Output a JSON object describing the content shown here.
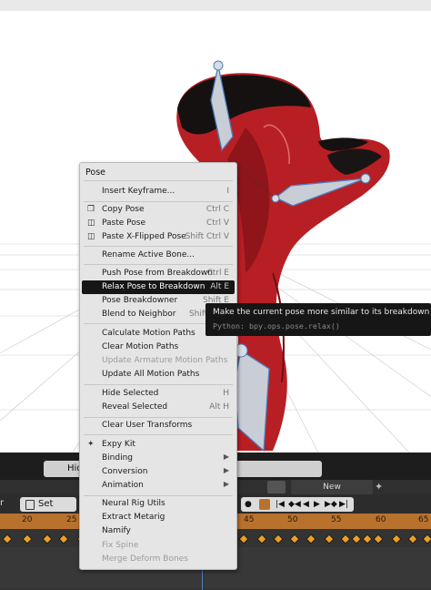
{
  "menu": {
    "title": "Pose",
    "items": [
      {
        "label": "Insert Keyframe...",
        "shortcut": "I",
        "icon": ""
      },
      {
        "label": "Copy Pose",
        "shortcut": "Ctrl C",
        "icon": "copy-icon"
      },
      {
        "label": "Paste Pose",
        "shortcut": "Ctrl V",
        "icon": "paste-icon"
      },
      {
        "label": "Paste X-Flipped Pose",
        "shortcut": "Shift Ctrl V",
        "icon": "paste-flipped-icon"
      },
      {
        "label": "Rename Active Bone...",
        "shortcut": ""
      },
      {
        "label": "Push Pose from Breakdown",
        "shortcut": "Ctrl E"
      },
      {
        "label": "Relax Pose to Breakdown",
        "shortcut": "Alt E"
      },
      {
        "label": "Pose Breakdowner",
        "shortcut": "Shift E"
      },
      {
        "label": "Blend to Neighbor",
        "shortcut": "Shift Alt E"
      },
      {
        "label": "Calculate Motion Paths",
        "shortcut": ""
      },
      {
        "label": "Clear Motion Paths",
        "shortcut": ""
      },
      {
        "label": "Update Armature Motion Paths",
        "shortcut": ""
      },
      {
        "label": "Update All Motion Paths",
        "shortcut": ""
      },
      {
        "label": "Hide Selected",
        "shortcut": "H"
      },
      {
        "label": "Reveal Selected",
        "shortcut": "Alt H"
      },
      {
        "label": "Clear User Transforms",
        "shortcut": ""
      },
      {
        "label": "Expy Kit",
        "icon": "armature-running-icon"
      },
      {
        "label": "Binding"
      },
      {
        "label": "Conversion"
      },
      {
        "label": "Animation"
      },
      {
        "label": "Neural Rig Utils"
      },
      {
        "label": "Extract Metarig"
      },
      {
        "label": "Namify"
      },
      {
        "label": "Fix Spine"
      },
      {
        "label": "Merge Deform Bones"
      }
    ]
  },
  "tooltip": {
    "description": "Make the current pose more similar to its breakdown pose.",
    "python": "Python: bpy.ops.pose.relax()"
  },
  "timeline": {
    "hide_label": "Hid",
    "action_label": "New",
    "range_label": "r",
    "set_start_label": "Set Start",
    "ticks": [
      "20",
      "25",
      "45",
      "50",
      "55",
      "60",
      "65"
    ]
  },
  "colors": {
    "accent_active": "#161616",
    "ruler": "#b8722e",
    "keyframe": "#e8a02a",
    "character_red": "#c0262a"
  }
}
